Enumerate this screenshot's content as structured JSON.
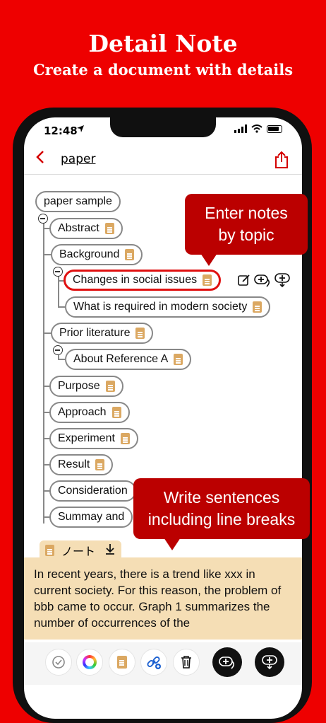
{
  "hero": {
    "title": "Detail Note",
    "subtitle": "Create a document with details"
  },
  "status": {
    "time": "12:48",
    "location_icon": "location-arrow-icon"
  },
  "nav": {
    "back_icon": "chevron-left-icon",
    "title": "paper",
    "share_icon": "share-icon"
  },
  "tree": {
    "root": "paper sample",
    "nodes": {
      "abstract": "Abstract",
      "background": "Background",
      "changes": "Changes in social issues",
      "required": "What is required in modern society",
      "prior": "Prior literature",
      "reference": "About Reference A",
      "purpose": "Purpose",
      "approach": "Approach",
      "experiment": "Experiment",
      "result": "Result",
      "consideration": "Consideration",
      "summary": "Summay and"
    }
  },
  "callouts": {
    "topic": "Enter notes\nby topic",
    "sentences": "Write sentences\nincluding line breaks"
  },
  "note": {
    "tab_label": "ノート",
    "text": "In recent years, there is a trend like xxx in current society. For this reason, the problem of bbb came to occur. Graph 1 summarizes the number of occurrences of the"
  },
  "colors": {
    "brand_red": "#ee0000",
    "accent_red": "#d40000",
    "note_bg": "#f5deb5",
    "doc_icon": "#dba862"
  }
}
